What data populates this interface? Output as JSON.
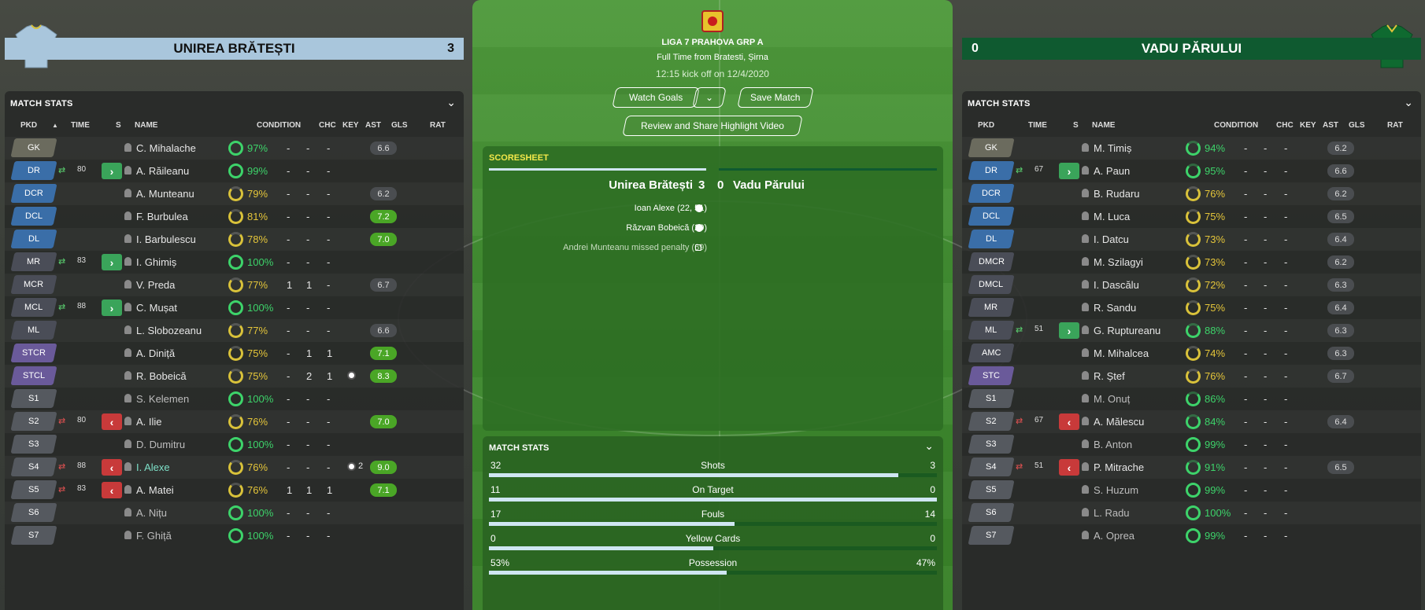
{
  "home": {
    "name": "UNIREA BRĂTEȘTI",
    "score": "3",
    "panel_title": "MATCH STATS",
    "columns": [
      "PKD",
      "TIME",
      "S",
      "NAME",
      "CONDITION",
      "CHC",
      "KEY",
      "AST",
      "GLS",
      "RAT"
    ],
    "players": [
      {
        "pos": "GK",
        "group": "gk",
        "name": "C. Mihalache",
        "cond": "97%",
        "cc": "g",
        "chc": "-",
        "key": "-",
        "ast": "-",
        "gls": "",
        "rat": "6.6",
        "rc": ""
      },
      {
        "pos": "DR",
        "group": "def",
        "swap": "in",
        "mins": "80",
        "name": "A. Răileanu",
        "cond": "99%",
        "cc": "g",
        "chc": "-",
        "key": "-",
        "ast": "-",
        "gls": "",
        "rat": "",
        "rc": "empty"
      },
      {
        "pos": "DCR",
        "group": "def",
        "name": "A. Munteanu",
        "cond": "79%",
        "cc": "y",
        "chc": "-",
        "key": "-",
        "ast": "-",
        "gls": "",
        "rat": "6.2",
        "rc": ""
      },
      {
        "pos": "DCL",
        "group": "def",
        "name": "F. Burbulea",
        "cond": "81%",
        "cc": "y",
        "chc": "-",
        "key": "-",
        "ast": "-",
        "gls": "",
        "rat": "7.2",
        "rc": "green"
      },
      {
        "pos": "DL",
        "group": "def",
        "name": "I. Barbulescu",
        "cond": "78%",
        "cc": "y",
        "chc": "-",
        "key": "-",
        "ast": "-",
        "gls": "",
        "rat": "7.0",
        "rc": "green"
      },
      {
        "pos": "MR",
        "group": "mid",
        "swap": "in",
        "mins": "83",
        "name": "I. Ghimiș",
        "cond": "100%",
        "cc": "g",
        "chc": "-",
        "key": "-",
        "ast": "-",
        "gls": "",
        "rat": "",
        "rc": "empty"
      },
      {
        "pos": "MCR",
        "group": "mid",
        "name": "V. Preda",
        "cond": "77%",
        "cc": "y",
        "chc": "1",
        "key": "1",
        "ast": "-",
        "gls": "",
        "rat": "6.7",
        "rc": ""
      },
      {
        "pos": "MCL",
        "group": "mid",
        "swap": "in",
        "mins": "88",
        "name": "C. Mușat",
        "cond": "100%",
        "cc": "g",
        "chc": "-",
        "key": "-",
        "ast": "-",
        "gls": "",
        "rat": "",
        "rc": "empty"
      },
      {
        "pos": "ML",
        "group": "mid",
        "name": "L. Slobozeanu",
        "cond": "77%",
        "cc": "y",
        "chc": "-",
        "key": "-",
        "ast": "-",
        "gls": "",
        "rat": "6.6",
        "rc": ""
      },
      {
        "pos": "STCR",
        "group": "att",
        "name": "A. Diniță",
        "cond": "75%",
        "cc": "y",
        "chc": "-",
        "key": "1",
        "ast": "1",
        "gls": "",
        "rat": "7.1",
        "rc": "green"
      },
      {
        "pos": "STCL",
        "group": "att",
        "name": "R. Bobeică",
        "cond": "75%",
        "cc": "y",
        "chc": "-",
        "key": "2",
        "ast": "1",
        "gls": "ball",
        "rat": "8.3",
        "rc": "green"
      },
      {
        "pos": "S1",
        "group": "sub",
        "name": "S. Kelemen",
        "cond": "100%",
        "cc": "g",
        "sub": true,
        "chc": "-",
        "key": "-",
        "ast": "-",
        "gls": "",
        "rat": "",
        "rc": "empty"
      },
      {
        "pos": "S2",
        "group": "sub",
        "swap": "out",
        "mins": "80",
        "name": "A. Ilie",
        "cond": "76%",
        "cc": "y",
        "chc": "-",
        "key": "-",
        "ast": "-",
        "gls": "",
        "rat": "7.0",
        "rc": "green"
      },
      {
        "pos": "S3",
        "group": "sub",
        "name": "D. Dumitru",
        "cond": "100%",
        "cc": "g",
        "sub": true,
        "chc": "-",
        "key": "-",
        "ast": "-",
        "gls": "",
        "rat": "",
        "rc": "empty"
      },
      {
        "pos": "S4",
        "group": "sub",
        "swap": "out",
        "mins": "88",
        "name": "I. Alexe",
        "cond": "76%",
        "cc": "y",
        "hl": true,
        "chc": "-",
        "key": "-",
        "ast": "-",
        "gls": "ball2",
        "gls_count": "2",
        "rat": "9.0",
        "rc": "green"
      },
      {
        "pos": "S5",
        "group": "sub",
        "swap": "out",
        "mins": "83",
        "name": "A. Matei",
        "cond": "76%",
        "cc": "y",
        "chc": "1",
        "key": "1",
        "ast": "1",
        "gls": "",
        "rat": "7.1",
        "rc": "green"
      },
      {
        "pos": "S6",
        "group": "sub",
        "name": "A. Nițu",
        "cond": "100%",
        "cc": "g",
        "sub": true,
        "chc": "-",
        "key": "-",
        "ast": "-",
        "gls": "",
        "rat": "",
        "rc": "empty"
      },
      {
        "pos": "S7",
        "group": "sub",
        "name": "F. Ghiță",
        "cond": "100%",
        "cc": "g",
        "sub": true,
        "chc": "-",
        "key": "-",
        "ast": "-",
        "gls": "",
        "rat": "",
        "rc": "empty"
      }
    ]
  },
  "away": {
    "name": "VADU PĂRULUI",
    "score": "0",
    "panel_title": "MATCH STATS",
    "columns": [
      "PKD",
      "TIME",
      "S",
      "NAME",
      "CONDITION",
      "CHC",
      "KEY",
      "AST",
      "GLS",
      "RAT"
    ],
    "players": [
      {
        "pos": "GK",
        "group": "gk",
        "name": "M. Timiș",
        "cond": "94%",
        "cc": "g2",
        "chc": "-",
        "key": "-",
        "ast": "-",
        "gls": "",
        "rat": "6.2",
        "rc": ""
      },
      {
        "pos": "DR",
        "group": "def",
        "swap": "in",
        "mins": "67",
        "name": "A. Paun",
        "cond": "95%",
        "cc": "g2",
        "chc": "-",
        "key": "-",
        "ast": "-",
        "gls": "",
        "rat": "6.6",
        "rc": ""
      },
      {
        "pos": "DCR",
        "group": "def",
        "name": "B. Rudaru",
        "cond": "76%",
        "cc": "y",
        "chc": "-",
        "key": "-",
        "ast": "-",
        "gls": "",
        "rat": "6.2",
        "rc": ""
      },
      {
        "pos": "DCL",
        "group": "def",
        "name": "M. Luca",
        "cond": "75%",
        "cc": "y",
        "chc": "-",
        "key": "-",
        "ast": "-",
        "gls": "",
        "rat": "6.5",
        "rc": ""
      },
      {
        "pos": "DL",
        "group": "def",
        "name": "I. Datcu",
        "cond": "73%",
        "cc": "y",
        "chc": "-",
        "key": "-",
        "ast": "-",
        "gls": "",
        "rat": "6.4",
        "rc": ""
      },
      {
        "pos": "DMCR",
        "group": "mid",
        "name": "M. Szilagyi",
        "cond": "73%",
        "cc": "y",
        "chc": "-",
        "key": "-",
        "ast": "-",
        "gls": "",
        "rat": "6.2",
        "rc": ""
      },
      {
        "pos": "DMCL",
        "group": "mid",
        "name": "I. Dascălu",
        "cond": "72%",
        "cc": "y",
        "chc": "-",
        "key": "-",
        "ast": "-",
        "gls": "",
        "rat": "6.3",
        "rc": ""
      },
      {
        "pos": "MR",
        "group": "mid",
        "name": "R. Sandu",
        "cond": "75%",
        "cc": "y",
        "chc": "-",
        "key": "-",
        "ast": "-",
        "gls": "",
        "rat": "6.4",
        "rc": ""
      },
      {
        "pos": "ML",
        "group": "mid",
        "swap": "in",
        "mins": "51",
        "name": "G. Ruptureanu",
        "cond": "88%",
        "cc": "g2",
        "chc": "-",
        "key": "-",
        "ast": "-",
        "gls": "",
        "rat": "6.3",
        "rc": ""
      },
      {
        "pos": "AMC",
        "group": "mid",
        "name": "M. Mihalcea",
        "cond": "74%",
        "cc": "y",
        "chc": "-",
        "key": "-",
        "ast": "-",
        "gls": "",
        "rat": "6.3",
        "rc": ""
      },
      {
        "pos": "STC",
        "group": "att",
        "name": "R. Ștef",
        "cond": "76%",
        "cc": "y",
        "chc": "-",
        "key": "-",
        "ast": "-",
        "gls": "",
        "rat": "6.7",
        "rc": ""
      },
      {
        "pos": "S1",
        "group": "sub",
        "name": "M. Onuț",
        "cond": "86%",
        "cc": "g2",
        "sub": true,
        "chc": "-",
        "key": "-",
        "ast": "-",
        "gls": "",
        "rat": "",
        "rc": "empty"
      },
      {
        "pos": "S2",
        "group": "sub",
        "swap": "out",
        "mins": "67",
        "name": "A. Mălescu",
        "cond": "84%",
        "cc": "g2",
        "chc": "-",
        "key": "-",
        "ast": "-",
        "gls": "",
        "rat": "6.4",
        "rc": ""
      },
      {
        "pos": "S3",
        "group": "sub",
        "name": "B. Anton",
        "cond": "99%",
        "cc": "g",
        "sub": true,
        "chc": "-",
        "key": "-",
        "ast": "-",
        "gls": "",
        "rat": "",
        "rc": "empty"
      },
      {
        "pos": "S4",
        "group": "sub",
        "swap": "out",
        "mins": "51",
        "name": "P. Mitrache",
        "cond": "91%",
        "cc": "g2",
        "chc": "-",
        "key": "-",
        "ast": "-",
        "gls": "",
        "rat": "6.5",
        "rc": ""
      },
      {
        "pos": "S5",
        "group": "sub",
        "name": "S. Huzum",
        "cond": "99%",
        "cc": "g",
        "sub": true,
        "chc": "-",
        "key": "-",
        "ast": "-",
        "gls": "",
        "rat": "",
        "rc": "empty"
      },
      {
        "pos": "S6",
        "group": "sub",
        "name": "L. Radu",
        "cond": "100%",
        "cc": "g",
        "sub": true,
        "chc": "-",
        "key": "-",
        "ast": "-",
        "gls": "",
        "rat": "",
        "rc": "empty"
      },
      {
        "pos": "S7",
        "group": "sub",
        "name": "A. Oprea",
        "cond": "99%",
        "cc": "g",
        "sub": true,
        "chc": "-",
        "key": "-",
        "ast": "-",
        "gls": "",
        "rat": "",
        "rc": "empty"
      }
    ]
  },
  "match": {
    "competition": "LIGA 7 PRAHOVA GRP A",
    "status": "Full Time from Bratesti, Șirna",
    "kickoff": "12:15 kick off on 12/4/2020",
    "watch_goals_label": "Watch Goals",
    "watch_goals_chevron": "⌄",
    "save_match_label": "Save Match",
    "review_label": "Review and Share Highlight Video"
  },
  "scoresheet": {
    "title": "SCORESHEET",
    "home_team": "Unirea Brătești",
    "home_score": "3",
    "away_score": "0",
    "away_team": "Vadu Părului",
    "events": [
      {
        "text": "Ioan Alexe (22, 51)",
        "type": "goal"
      },
      {
        "text": "Răzvan Bobeică (29)",
        "type": "goal"
      },
      {
        "text": "Andrei Munteanu missed penalty (69)",
        "type": "pen"
      }
    ]
  },
  "match_stats": {
    "title": "MATCH STATS",
    "stats": [
      {
        "label": "Shots",
        "home": "32",
        "away": "3",
        "home_share": 0.914
      },
      {
        "label": "On Target",
        "home": "11",
        "away": "0",
        "home_share": 1.0
      },
      {
        "label": "Fouls",
        "home": "17",
        "away": "14",
        "home_share": 0.548
      },
      {
        "label": "Yellow Cards",
        "home": "0",
        "away": "0",
        "home_share": 0.5
      },
      {
        "label": "Possession",
        "home": "53%",
        "away": "47%",
        "home_share": 0.53
      }
    ]
  },
  "colors": {
    "accent_green": "#3dd36a",
    "accent_yellow": "#e4c53a",
    "home_bar": "#a9c6dc",
    "away_bar": "#0f5a30"
  }
}
